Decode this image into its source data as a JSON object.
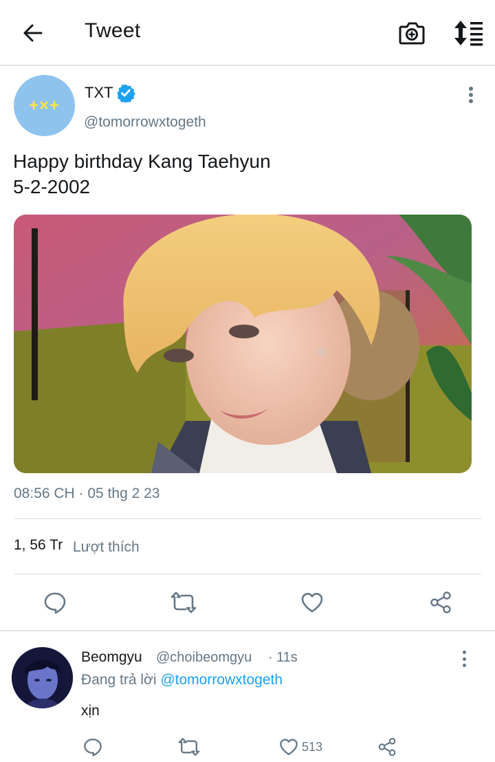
{
  "header": {
    "title": "Tweet",
    "icons": [
      "back-arrow-icon",
      "camera-plus-icon",
      "sort-icon"
    ]
  },
  "tweet": {
    "author_name": "TXT",
    "author_handle": "@tomorrowxtogeth",
    "avatar_text": "+×+",
    "verified": true,
    "text_line1": "Happy birthday Kang Taehyun",
    "text_line2": "5-2-2002",
    "timestamp": "08:56 CH · 05 thg 2 23",
    "likes_count": "1, 56 Tr",
    "likes_label": "Lượt thích",
    "actions": [
      "reply-icon",
      "retweet-icon",
      "like-icon",
      "share-icon"
    ]
  },
  "reply": {
    "author_name": "Beomgyu",
    "author_handle": "@choibeomgyu",
    "separator": "·",
    "time": "11s",
    "replying_prefix": "Đang trả lời",
    "replying_to": "@tomorrowxtogeth",
    "text": "xịn",
    "like_count": "513"
  },
  "colors": {
    "accent": "#1da1f2",
    "secondary_text": "#657786",
    "avatar_bg": "#8ec3ee",
    "avatar_symbols": "#ffe34a"
  }
}
